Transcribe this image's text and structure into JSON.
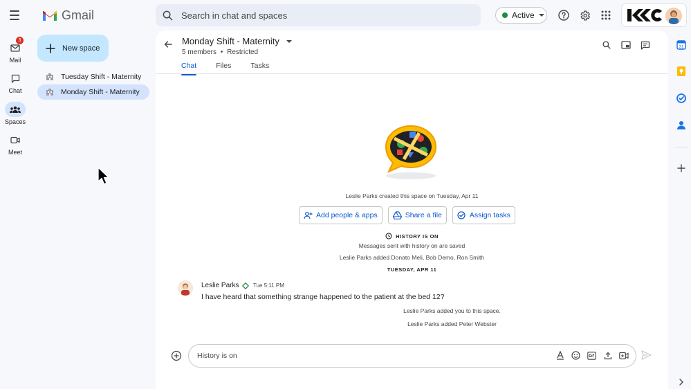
{
  "app": {
    "name": "Gmail"
  },
  "search": {
    "placeholder": "Search in chat and spaces"
  },
  "status": {
    "label": "Active",
    "color": "#1e8e3e"
  },
  "top_icons": [
    "help-icon",
    "settings-icon",
    "apps-grid-icon"
  ],
  "profile": {
    "org_logo_text": "KC"
  },
  "rail": {
    "items": [
      {
        "label": "Mail",
        "icon": "mail-icon",
        "badge": "3"
      },
      {
        "label": "Chat",
        "icon": "chat-icon"
      },
      {
        "label": "Spaces",
        "icon": "spaces-icon",
        "active": true
      },
      {
        "label": "Meet",
        "icon": "video-icon"
      }
    ]
  },
  "sidebar": {
    "new_space_label": "New space",
    "spaces": [
      {
        "name": "Tuesday Shift - Maternity"
      },
      {
        "name": "Monday Shift - Maternity",
        "active": true
      }
    ]
  },
  "space": {
    "title": "Monday Shift - Maternity",
    "members": "5 members",
    "separator": "•",
    "access": "Restricted",
    "tabs": [
      {
        "label": "Chat",
        "active": true
      },
      {
        "label": "Files"
      },
      {
        "label": "Tasks"
      }
    ]
  },
  "chat": {
    "created_note": "Leslie Parks created this space on Tuesday, Apr 11",
    "actions": {
      "add_people": "Add people & apps",
      "share_file": "Share a file",
      "assign_tasks": "Assign tasks"
    },
    "history_heading": "HISTORY IS ON",
    "history_sub": "Messages sent with history on are saved",
    "added_note": "Leslie Parks added Donato Meli, Bob Demo, Ron Smith",
    "date_divider": "TUESDAY, APR 11",
    "message": {
      "author": "Leslie Parks",
      "time": "Tue 5:11 PM",
      "text": "I have heard that something strange happened to the patient at the bed 12?"
    },
    "system_1": "Leslie Parks added you to this space.",
    "system_2": "Leslie Parks added Peter Webster"
  },
  "composer": {
    "placeholder": "History is on"
  },
  "colors": {
    "accent": "#0b57d0",
    "selected": "#d3e3fd",
    "new_space_bg": "#c2e7ff",
    "badge": "#d93025"
  }
}
